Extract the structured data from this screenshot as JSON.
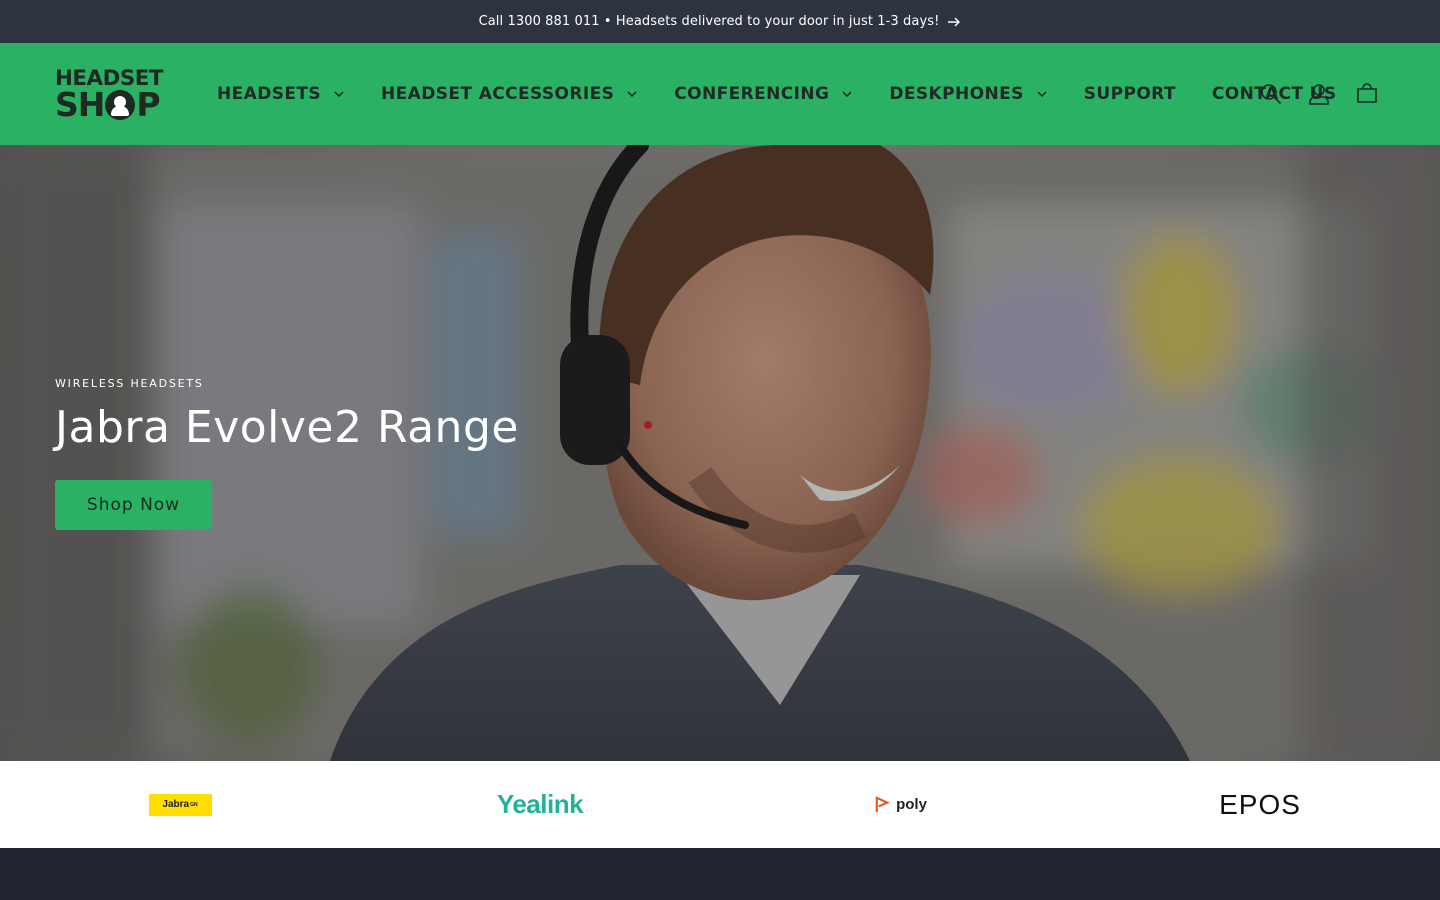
{
  "announcement": {
    "text": "Call 1300 881 011 • Headsets delivered to your door in just 1-3 days!",
    "icon": "arrow-right-icon"
  },
  "header": {
    "logo": {
      "line1": "HEADSET",
      "line2_left": "SH",
      "line2_right": "P"
    },
    "nav": [
      {
        "label": "HEADSETS",
        "dropdown": true
      },
      {
        "label": "HEADSET ACCESSORIES",
        "dropdown": true
      },
      {
        "label": "CONFERENCING",
        "dropdown": true
      },
      {
        "label": "DESKPHONES",
        "dropdown": true
      },
      {
        "label": "SUPPORT",
        "dropdown": false
      },
      {
        "label": "CONTACT US",
        "dropdown": false
      }
    ],
    "icons": [
      "search-icon",
      "account-icon",
      "cart-icon"
    ]
  },
  "hero": {
    "eyebrow": "WIRELESS HEADSETS",
    "title": "Jabra Evolve2 Range",
    "button_label": "Shop Now"
  },
  "brands": [
    {
      "name": "Jabra",
      "mark": "GN"
    },
    {
      "name": "Yealink"
    },
    {
      "name": "poly"
    },
    {
      "name": "EPOS"
    }
  ],
  "colors": {
    "brand_green": "#2bb163",
    "announcement_bg": "#2d3440",
    "dark_text": "#1e2a26",
    "footer_bg": "#202330",
    "jabra_yellow": "#ffde00",
    "yealink_teal": "#21b29a",
    "poly_orange": "#e8541a"
  }
}
